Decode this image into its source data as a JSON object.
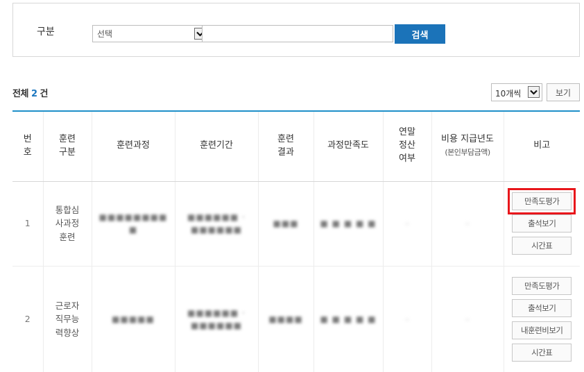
{
  "search": {
    "label": "구분",
    "select_value": "선택",
    "input_value": "",
    "button_label": "검색"
  },
  "summary": {
    "prefix": "전체",
    "count": "2",
    "suffix": "건"
  },
  "pagination": {
    "per_page_value": "10개씩",
    "view_button": "보기"
  },
  "table": {
    "headers": {
      "no": [
        "번",
        "호"
      ],
      "type": [
        "훈련",
        "구분"
      ],
      "course": "훈련과정",
      "period": "훈련기간",
      "result": [
        "훈련",
        "결과"
      ],
      "satisfaction": "과정만족도",
      "settlement": [
        "연말",
        "정산",
        "여부"
      ],
      "cost_year": "비용 지급년도",
      "cost_year_sub": "(본인부담금액)",
      "note": "비고"
    },
    "rows": [
      {
        "no": "1",
        "type_lines": [
          "통합심",
          "사과정",
          "훈련"
        ],
        "buttons": {
          "satisfaction_eval": "만족도평가",
          "attendance": "출석보기",
          "timetable": "시간표"
        }
      },
      {
        "no": "2",
        "type_lines": [
          "근로자",
          "직무능",
          "력향상"
        ],
        "buttons": {
          "satisfaction_eval": "만족도평가",
          "attendance": "출석보기",
          "my_cost": "내훈련비보기",
          "timetable": "시간표"
        }
      }
    ]
  },
  "colors": {
    "accent_blue": "#1b73b9",
    "header_rule": "#1e8fc9",
    "highlight_red": "#e8161b"
  }
}
